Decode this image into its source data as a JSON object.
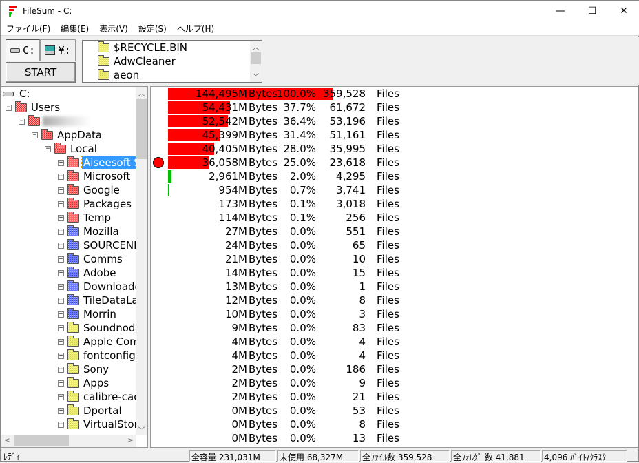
{
  "window": {
    "title": "FileSum - C:",
    "minimize": "—",
    "maximize": "☐",
    "close": "✕"
  },
  "menu": [
    "ファイル(F)",
    "編集(E)",
    "表示(V)",
    "設定(S)",
    "ヘルプ(H)"
  ],
  "toolbar": {
    "drive_local": "C:",
    "drive_network": "¥:",
    "start_label": "START",
    "folder_list": [
      "$RECYCLE.BIN",
      "AdwCleaner",
      "aeon"
    ]
  },
  "tree": [
    {
      "label": "C:",
      "level": 0,
      "icon": "drive",
      "exp": ""
    },
    {
      "label": "Users",
      "level": 1,
      "icon": "red-open",
      "exp": "-"
    },
    {
      "label": "",
      "level": 2,
      "icon": "red-open",
      "exp": "-",
      "blurred": true
    },
    {
      "label": "AppData",
      "level": 3,
      "icon": "red-open",
      "exp": "-"
    },
    {
      "label": "Local",
      "level": 4,
      "icon": "red-open",
      "exp": "-"
    },
    {
      "label": "Aiseesoft Studio",
      "level": 5,
      "icon": "red",
      "exp": "+",
      "selected": true
    },
    {
      "label": "Microsoft",
      "level": 5,
      "icon": "red",
      "exp": "+"
    },
    {
      "label": "Google",
      "level": 5,
      "icon": "red",
      "exp": "+"
    },
    {
      "label": "Packages",
      "level": 5,
      "icon": "red",
      "exp": "+"
    },
    {
      "label": "Temp",
      "level": 5,
      "icon": "red",
      "exp": "+"
    },
    {
      "label": "Mozilla",
      "level": 5,
      "icon": "blue",
      "exp": "+"
    },
    {
      "label": "SOURCENEXT",
      "level": 5,
      "icon": "blue",
      "exp": "+"
    },
    {
      "label": "Comms",
      "level": 5,
      "icon": "blue",
      "exp": "+"
    },
    {
      "label": "Adobe",
      "level": 5,
      "icon": "blue",
      "exp": "+"
    },
    {
      "label": "Downloaded",
      "level": 5,
      "icon": "blue",
      "exp": "+"
    },
    {
      "label": "TileDataLayer",
      "level": 5,
      "icon": "blue",
      "exp": "+"
    },
    {
      "label": "Morrin",
      "level": 5,
      "icon": "blue",
      "exp": "+"
    },
    {
      "label": "Soundnode",
      "level": 5,
      "icon": "yellow",
      "exp": "+"
    },
    {
      "label": "Apple Computer",
      "level": 5,
      "icon": "yellow",
      "exp": "+"
    },
    {
      "label": "fontconfig",
      "level": 5,
      "icon": "yellow",
      "exp": "+"
    },
    {
      "label": "Sony",
      "level": 5,
      "icon": "yellow",
      "exp": "+"
    },
    {
      "label": "Apps",
      "level": 5,
      "icon": "yellow",
      "exp": "+"
    },
    {
      "label": "calibre-cache",
      "level": 5,
      "icon": "yellow",
      "exp": "+"
    },
    {
      "label": "Dportal",
      "level": 5,
      "icon": "yellow",
      "exp": "+"
    },
    {
      "label": "VirtualStore",
      "level": 5,
      "icon": "yellow",
      "exp": "+"
    }
  ],
  "colors": {
    "big_bar": "#ff0000",
    "small_bar": "#00c000",
    "selection": "#3399ff"
  },
  "rows": [
    {
      "size": "144,495M",
      "unit": "Bytes",
      "pct": "100.0%",
      "pct_value": 100.0,
      "files": "359,528",
      "files_unit": "Files",
      "bar": "red"
    },
    {
      "size": "54,431M",
      "unit": "Bytes",
      "pct": "37.7%",
      "pct_value": 37.7,
      "files": "61,672",
      "files_unit": "Files",
      "bar": "red"
    },
    {
      "size": "52,542M",
      "unit": "Bytes",
      "pct": "36.4%",
      "pct_value": 36.4,
      "files": "53,196",
      "files_unit": "Files",
      "bar": "red"
    },
    {
      "size": "45,399M",
      "unit": "Bytes",
      "pct": "31.4%",
      "pct_value": 31.4,
      "files": "51,161",
      "files_unit": "Files",
      "bar": "red"
    },
    {
      "size": "40,405M",
      "unit": "Bytes",
      "pct": "28.0%",
      "pct_value": 28.0,
      "files": "35,995",
      "files_unit": "Files",
      "bar": "red"
    },
    {
      "size": "36,058M",
      "unit": "Bytes",
      "pct": "25.0%",
      "pct_value": 25.0,
      "files": "23,618",
      "files_unit": "Files",
      "bar": "red",
      "marker": true
    },
    {
      "size": "2,961M",
      "unit": "Bytes",
      "pct": "2.0%",
      "pct_value": 2.0,
      "files": "4,295",
      "files_unit": "Files",
      "bar": "green"
    },
    {
      "size": "954M",
      "unit": "Bytes",
      "pct": "0.7%",
      "pct_value": 0.7,
      "files": "3,741",
      "files_unit": "Files",
      "bar": "green"
    },
    {
      "size": "173M",
      "unit": "Bytes",
      "pct": "0.1%",
      "files": "3,018",
      "files_unit": "Files"
    },
    {
      "size": "114M",
      "unit": "Bytes",
      "pct": "0.1%",
      "files": "256",
      "files_unit": "Files"
    },
    {
      "size": "27M",
      "unit": "Bytes",
      "pct": "0.0%",
      "files": "551",
      "files_unit": "Files"
    },
    {
      "size": "24M",
      "unit": "Bytes",
      "pct": "0.0%",
      "files": "65",
      "files_unit": "Files"
    },
    {
      "size": "21M",
      "unit": "Bytes",
      "pct": "0.0%",
      "files": "10",
      "files_unit": "Files"
    },
    {
      "size": "14M",
      "unit": "Bytes",
      "pct": "0.0%",
      "files": "15",
      "files_unit": "Files"
    },
    {
      "size": "13M",
      "unit": "Bytes",
      "pct": "0.0%",
      "files": "1",
      "files_unit": "Files"
    },
    {
      "size": "12M",
      "unit": "Bytes",
      "pct": "0.0%",
      "files": "8",
      "files_unit": "Files"
    },
    {
      "size": "10M",
      "unit": "Bytes",
      "pct": "0.0%",
      "files": "3",
      "files_unit": "Files"
    },
    {
      "size": "9M",
      "unit": "Bytes",
      "pct": "0.0%",
      "files": "83",
      "files_unit": "Files"
    },
    {
      "size": "4M",
      "unit": "Bytes",
      "pct": "0.0%",
      "files": "4",
      "files_unit": "Files"
    },
    {
      "size": "4M",
      "unit": "Bytes",
      "pct": "0.0%",
      "files": "4",
      "files_unit": "Files"
    },
    {
      "size": "2M",
      "unit": "Bytes",
      "pct": "0.0%",
      "files": "186",
      "files_unit": "Files"
    },
    {
      "size": "2M",
      "unit": "Bytes",
      "pct": "0.0%",
      "files": "9",
      "files_unit": "Files"
    },
    {
      "size": "2M",
      "unit": "Bytes",
      "pct": "0.0%",
      "files": "21",
      "files_unit": "Files"
    },
    {
      "size": "0M",
      "unit": "Bytes",
      "pct": "0.0%",
      "files": "53",
      "files_unit": "Files"
    },
    {
      "size": "0M",
      "unit": "Bytes",
      "pct": "0.0%",
      "files": "8",
      "files_unit": "Files"
    },
    {
      "size": "0M",
      "unit": "Bytes",
      "pct": "0.0%",
      "files": "13",
      "files_unit": "Files"
    }
  ],
  "status": {
    "ready": "ﾚﾃﾞｨ",
    "capacity": "全容量 231,031M",
    "free": "未使用 68,327M",
    "files": "全ﾌｧｲﾙ数 359,528",
    "folders": "全ﾌｫﾙﾀﾞ 数 41,881",
    "cluster": "4,096 ﾊﾞｲﾄ/ｸﾗｽﾀ"
  }
}
